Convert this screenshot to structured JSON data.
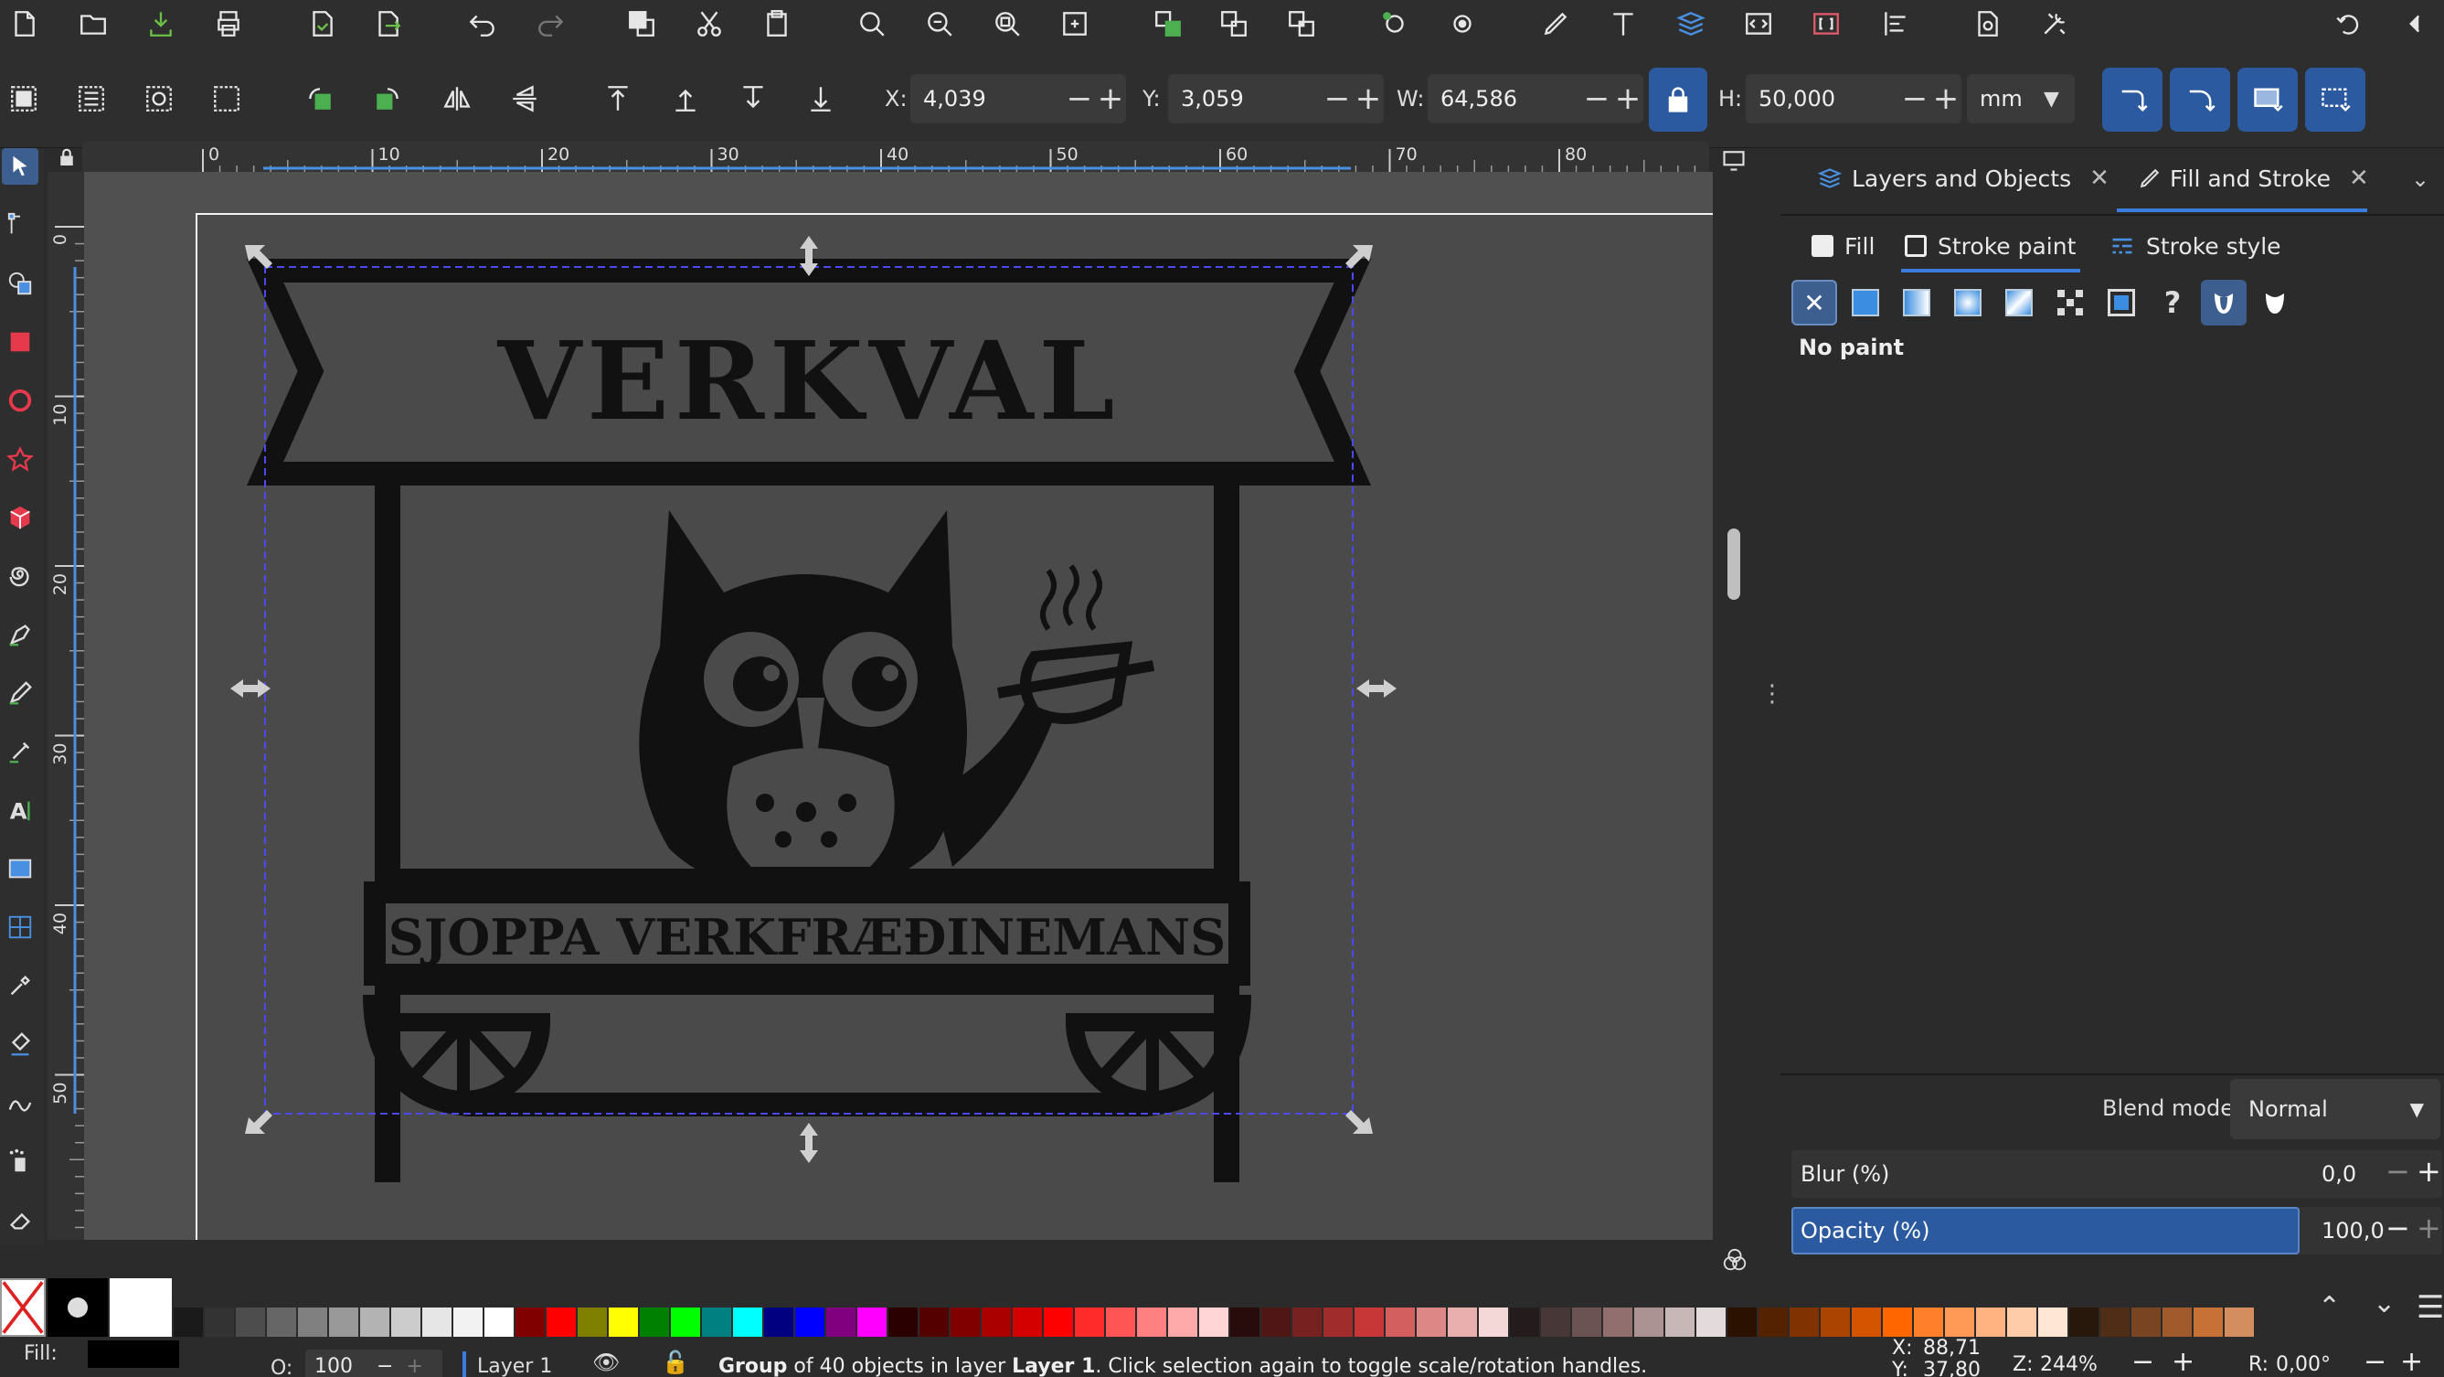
{
  "toolbar": {
    "x_label": "X:",
    "x_value": "4,039",
    "y_label": "Y:",
    "y_value": "3,059",
    "w_label": "W:",
    "w_value": "64,586",
    "h_label": "H:",
    "h_value": "50,000",
    "unit": "mm"
  },
  "ruler": {
    "h_ticks": [
      "0",
      "10",
      "20",
      "30",
      "40",
      "50",
      "60",
      "70",
      "80"
    ],
    "v_ticks": [
      "0",
      "10",
      "20",
      "30",
      "40",
      "50",
      "0"
    ]
  },
  "artwork": {
    "title": "VERKVAL",
    "subtitle": "SJOPPA VERKFRÆÐINEMANS"
  },
  "panel": {
    "tab_layers": "Layers and Objects",
    "tab_fill": "Fill and Stroke",
    "subtab_fill": "Fill",
    "subtab_stroke_paint": "Stroke paint",
    "subtab_stroke_style": "Stroke style",
    "paint_status": "No paint",
    "blend_label": "Blend mode:",
    "blend_value": "Normal",
    "blur_label": "Blur (%)",
    "blur_value": "0,0",
    "opacity_label": "Opacity (%)",
    "opacity_value": "100,0"
  },
  "palette": {
    "colors": [
      "#1a1a1a",
      "#333333",
      "#4d4d4d",
      "#666666",
      "#808080",
      "#999999",
      "#b3b3b3",
      "#cccccc",
      "#e6e6e6",
      "#f2f2f2",
      "#ffffff",
      "#800000",
      "#ff0000",
      "#808000",
      "#ffff00",
      "#008000",
      "#00ff00",
      "#008080",
      "#00ffff",
      "#000080",
      "#0000ff",
      "#800080",
      "#ff00ff",
      "#2b0000",
      "#550000",
      "#800000",
      "#aa0000",
      "#d40000",
      "#ff0000",
      "#ff2a2a",
      "#ff5555",
      "#ff8080",
      "#ffaaaa",
      "#ffd5d5",
      "#280b0b",
      "#501616",
      "#782121",
      "#a02c2c",
      "#c83737",
      "#d35f5f",
      "#de8787",
      "#e9afaf",
      "#f4d7d7",
      "#241c1c",
      "#483737",
      "#6c5353",
      "#916f6f",
      "#ac9393",
      "#c8b7b7",
      "#e3dbdb",
      "#2b1100",
      "#552200",
      "#803300",
      "#aa4400",
      "#d45500",
      "#ff6600",
      "#ff7f2a",
      "#ff9955",
      "#ffb380",
      "#ffccaa",
      "#ffe6d5",
      "#28170b",
      "#502d16",
      "#784421",
      "#a05a2c",
      "#c87137",
      "#d38d5f"
    ]
  },
  "status": {
    "fill_label": "Fill:",
    "o_label": "O:",
    "o_value": "100",
    "layer": "Layer 1",
    "message_bold": "Group",
    "message": " of 40 objects in layer ",
    "message_layer": "Layer 1",
    "message_tail": ". Click selection again to toggle scale/rotation handles.",
    "cursor_x_label": "X:",
    "cursor_x": "88,71",
    "cursor_y_label": "Y:",
    "cursor_y": "37,80",
    "zoom_label": "Z:",
    "zoom": "244%",
    "rot_label": "R:",
    "rotation": "0,00°"
  },
  "colors": {
    "accent": "#2b5aa0",
    "selection": "#3b3bd6"
  }
}
